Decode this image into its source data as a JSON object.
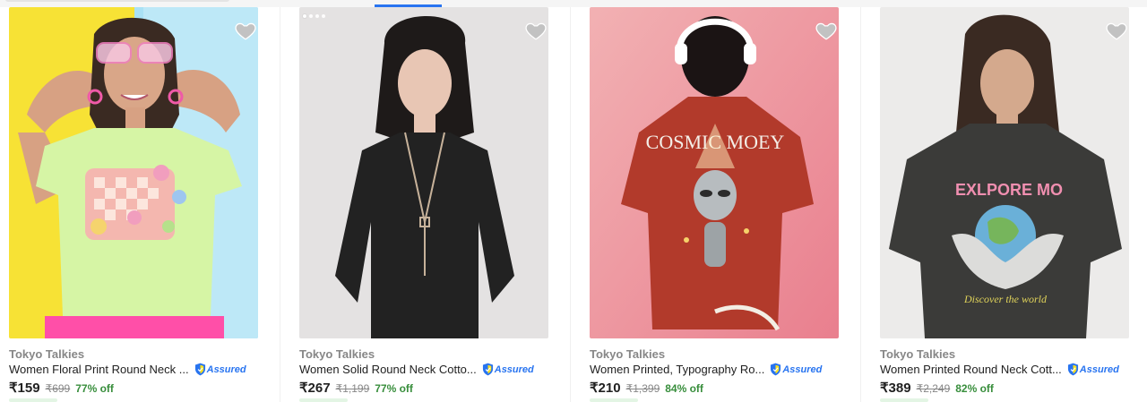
{
  "products": [
    {
      "brand": "Tokyo Talkies",
      "title": "Women Floral Print Round Neck ...",
      "assured": "Assured",
      "price": "₹159",
      "mrp": "₹699",
      "discount": "77% off"
    },
    {
      "brand": "Tokyo Talkies",
      "title": "Women Solid Round Neck Cotto...",
      "assured": "Assured",
      "price": "₹267",
      "mrp": "₹1,199",
      "discount": "77% off"
    },
    {
      "brand": "Tokyo Talkies",
      "title": "Women Printed, Typography Ro...",
      "assured": "Assured",
      "price": "₹210",
      "mrp": "₹1,399",
      "discount": "84% off"
    },
    {
      "brand": "Tokyo Talkies",
      "title": "Women Printed Round Neck Cott...",
      "assured": "Assured",
      "price": "₹389",
      "mrp": "₹2,249",
      "discount": "82% off"
    }
  ],
  "images": {
    "p3_print": "COSMIC MOEY",
    "p4_print_top": "EXLPORE MO",
    "p4_print_bottom": "Discover the world"
  },
  "icons": {
    "wishlist": "heart-icon",
    "assured": "assured-badge-icon"
  },
  "colors": {
    "accent": "#2874f0",
    "discount": "#388e3c",
    "muted": "#878787",
    "text": "#212121"
  }
}
